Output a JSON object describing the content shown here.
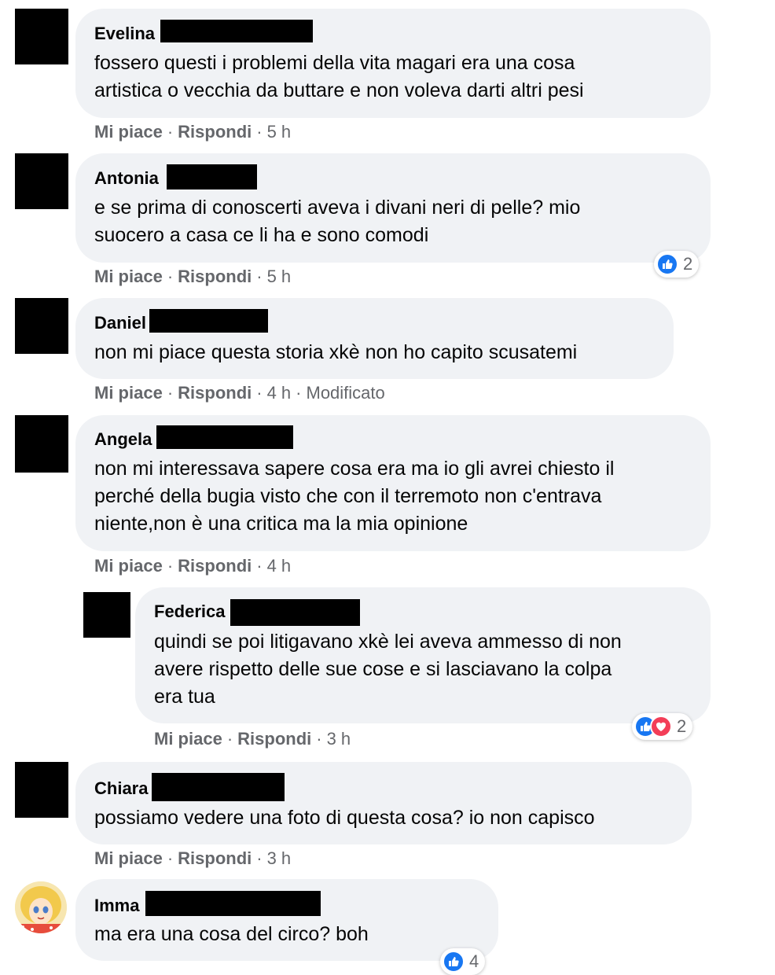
{
  "comments": [
    {
      "author": "Evelina",
      "text": "fossero questi i problemi della vita magari era una cosa\nartistica o vecchia da buttare e non voleva darti altri pesi",
      "like": "Mi piace",
      "reply": "Rispondi",
      "time": "5 h"
    },
    {
      "author": "Antonia",
      "text": "e se prima di conoscerti aveva i divani neri di pelle? mio\nsuocero a casa ce li ha e sono comodi",
      "like": "Mi piace",
      "reply": "Rispondi",
      "time": "5 h",
      "reaction_count": "2"
    },
    {
      "author": "Daniel",
      "text": "non mi piace questa storia xkè non ho capito scusatemi",
      "like": "Mi piace",
      "reply": "Rispondi",
      "time": "4 h",
      "edited": "Modificato"
    },
    {
      "author": "Angela",
      "text": "non mi interessava sapere cosa era ma io gli avrei chiesto il\nperché della bugia visto che con il terremoto non c'entrava\nniente,non è una critica ma la mia opinione",
      "like": "Mi piace",
      "reply": "Rispondi",
      "time": "4 h"
    },
    {
      "author": "Federica",
      "text": "quindi se poi litigavano xkè lei aveva ammesso di non\navere rispetto delle sue cose e si lasciavano la colpa\nera tua",
      "like": "Mi piace",
      "reply": "Rispondi",
      "time": "3 h",
      "reaction_count": "2"
    },
    {
      "author": "Chiara",
      "text": "possiamo vedere una foto di questa cosa? io non capisco",
      "like": "Mi piace",
      "reply": "Rispondi",
      "time": "3 h"
    },
    {
      "author": "Imma",
      "text": "ma era una cosa del circo? boh",
      "reaction_count": "4"
    }
  ],
  "colors": {
    "bubble": "#f0f2f5",
    "action_text": "#65676b",
    "like_blue": "#1877f2",
    "love_red": "#f33e58"
  },
  "icons": [
    "like-icon",
    "love-icon"
  ]
}
